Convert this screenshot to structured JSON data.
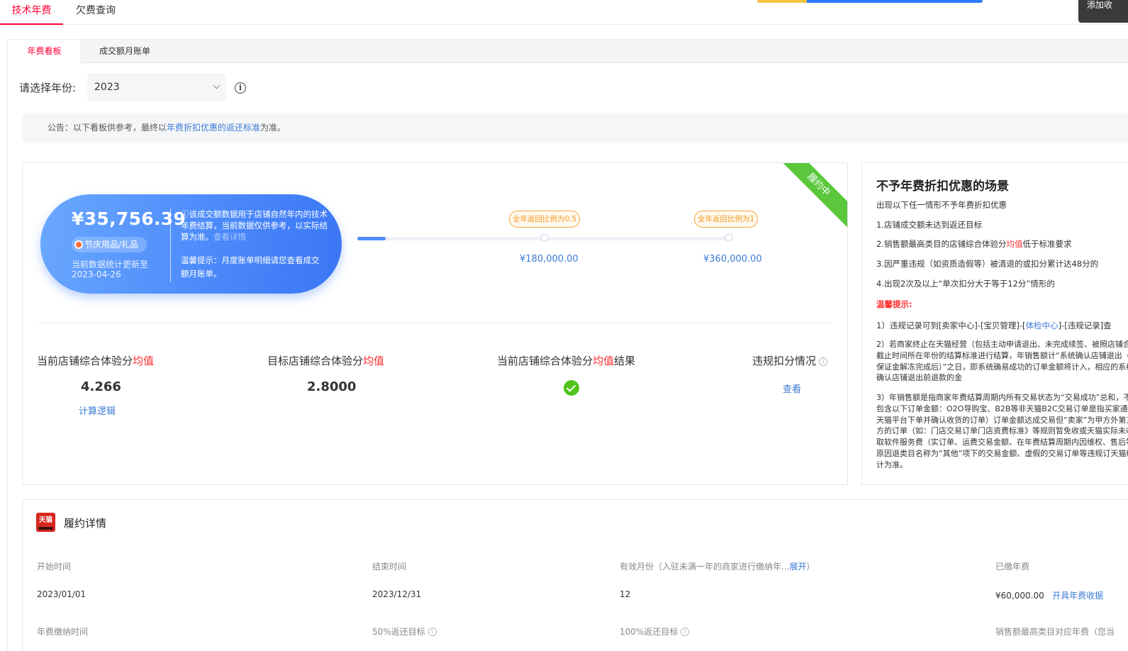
{
  "top_tabs": [
    "技术年费",
    "欠费查询"
  ],
  "side_button": "添加收",
  "sub_tabs": [
    "年费看板",
    "成交额月账单"
  ],
  "year": {
    "label": "请选择年份:",
    "value": "2023"
  },
  "notice": {
    "prefix": "公告：以下看板供参考，最终以",
    "link": "年费折扣优惠的返还标准",
    "suffix": "为准。"
  },
  "status_ribbon": "履约中",
  "sales": {
    "amount": "¥35,756.39",
    "category": "节庆用品/礼品",
    "updated_label": "当前数据统计更新至",
    "updated_date": "2023-04-26",
    "desc": "ⓘ该成交额数据用于店铺自然年内的技术年费结算，当前数据仅供参考，以实际结算为准。",
    "desc_dim": "查看详情",
    "tip": "温馨提示：月度账单明细请您查看成交额月账单。"
  },
  "progress": {
    "fraction": 0.075,
    "milestones": [
      {
        "tag": "全年返回比例为0.5",
        "amount": "¥180,000.00"
      },
      {
        "tag": "全年返回比例为1",
        "amount": "¥360,000.00"
      }
    ]
  },
  "metrics": {
    "m1": {
      "pre": "当前店铺综合体验分",
      "red": "均值",
      "post": "",
      "value": "4.266",
      "link": "计算逻辑"
    },
    "m2": {
      "pre": "目标店铺综合体验分",
      "red": "均值",
      "post": "",
      "value": "2.8000"
    },
    "m3": {
      "pre": "当前店铺综合体验分",
      "red": "均值",
      "post": "结果"
    },
    "m4": {
      "pre": "违规扣分情况",
      "link": "查看"
    }
  },
  "rules": {
    "title": "不予年费折扣优惠的场景",
    "intro": "出现以下任一情形不予年费折扣优惠",
    "items": [
      "1.店铺成交额未达到返还目标",
      "2.销售额最高类目的店铺综合体验分",
      "3.因严重违规（如资质造假等）被清退的或扣分累计达48分的",
      "4.出现2次及以上“单次扣分大于等于12分”情形的"
    ],
    "item2_red": "均值",
    "item2_tail": "低于标准要求",
    "warm_title": "温馨提示:",
    "tip1_pre": "1）违规记录可到[卖家中心]-[宝贝管理]-[",
    "tip1_link": "体检中心",
    "tip1_post": "]-[违规记录]查",
    "tip2": "2）若商家终止在天猫经营（包括主动申请退出、未完成续签、被照店铺合同截止时间所在年份的结算标准进行结算，年销售额计“系统确认店铺退出（在保证金解冻完成后）”之日，即系统确易成功的订单金额将计入，相应的系统确认店铺退出前退款的金",
    "tip3": "3）年销售额是指商家年费结算周期内所有交易状态为“交易成功”总和，不包含以下订单金额：O2O导购宝、B2B等非天猫B2C交易订单是指买家通过天猫平台下单并确认收货的订单）订单金额达成交易但“卖家”为甲方外第三方的订单（如：门店交易订单门店资费标准》等规则暂免收或天猫实际未收取软件服务费（实订单、运费交易金额、在年费结算周期内因维权、售后等原因退类目名称为“其他”项下的交易金额、虚假的交易订单等违规订天猫统计为准。"
  },
  "details": {
    "title": "履约详情",
    "logo_text": "天猫",
    "headers": [
      "开始时间",
      "结束时间",
      "有效月份（入驻未满一年的商家进行缴纳年...",
      "已缴年费"
    ],
    "expand_link": "展开",
    "expand_close": "）",
    "values": [
      "2023/01/01",
      "2023/12/31",
      "12",
      "¥60,000.00"
    ],
    "receipt_link": "开具年费收据",
    "headers2": [
      "年费缴纳时间",
      "50%返还目标",
      "100%返还目标",
      "销售额最高类目对应年费（您当"
    ]
  }
}
